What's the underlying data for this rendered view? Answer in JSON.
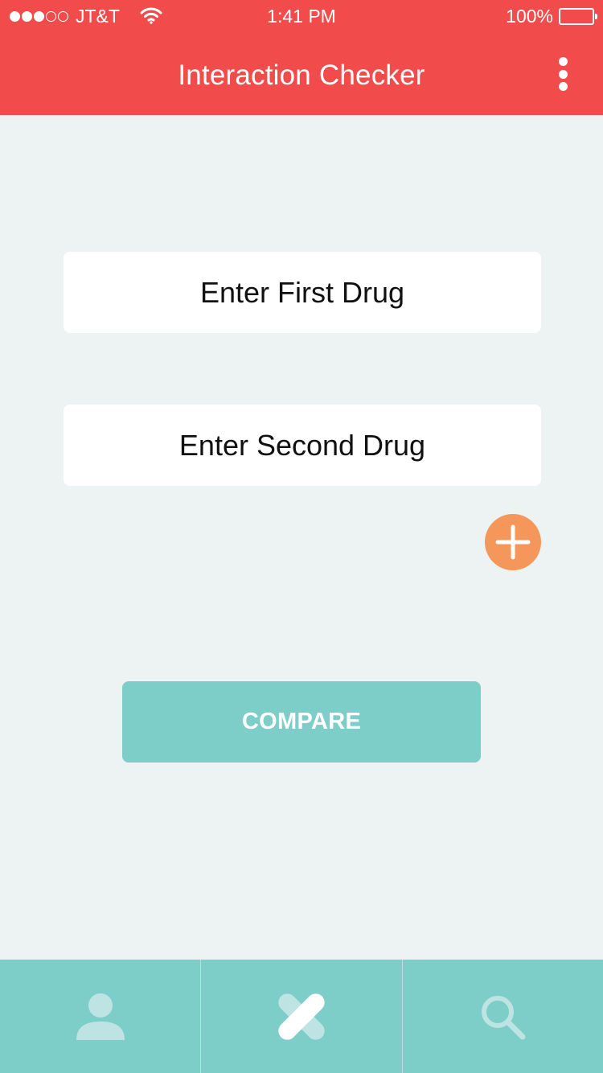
{
  "status_bar": {
    "signal_dots_filled": 3,
    "signal_dots_total": 5,
    "carrier": "JT&T",
    "time": "1:41 PM",
    "battery": "100%"
  },
  "header": {
    "title": "Interaction Checker",
    "menu_icon": "more-vertical-icon"
  },
  "form": {
    "first_drug_placeholder": "Enter First Drug",
    "first_drug_value": "",
    "second_drug_placeholder": "Enter Second Drug",
    "second_drug_value": "",
    "add_icon": "plus-icon",
    "compare_label": "COMPARE"
  },
  "tab_bar": {
    "tabs": [
      {
        "icon": "user-icon",
        "active": false
      },
      {
        "icon": "interaction-icon",
        "active": true
      },
      {
        "icon": "search-icon",
        "active": false
      }
    ]
  },
  "colors": {
    "header": "#F24B4B",
    "background": "#EDF2F2",
    "accent_teal": "#7DCDC9",
    "add_orange": "#F5965A"
  }
}
